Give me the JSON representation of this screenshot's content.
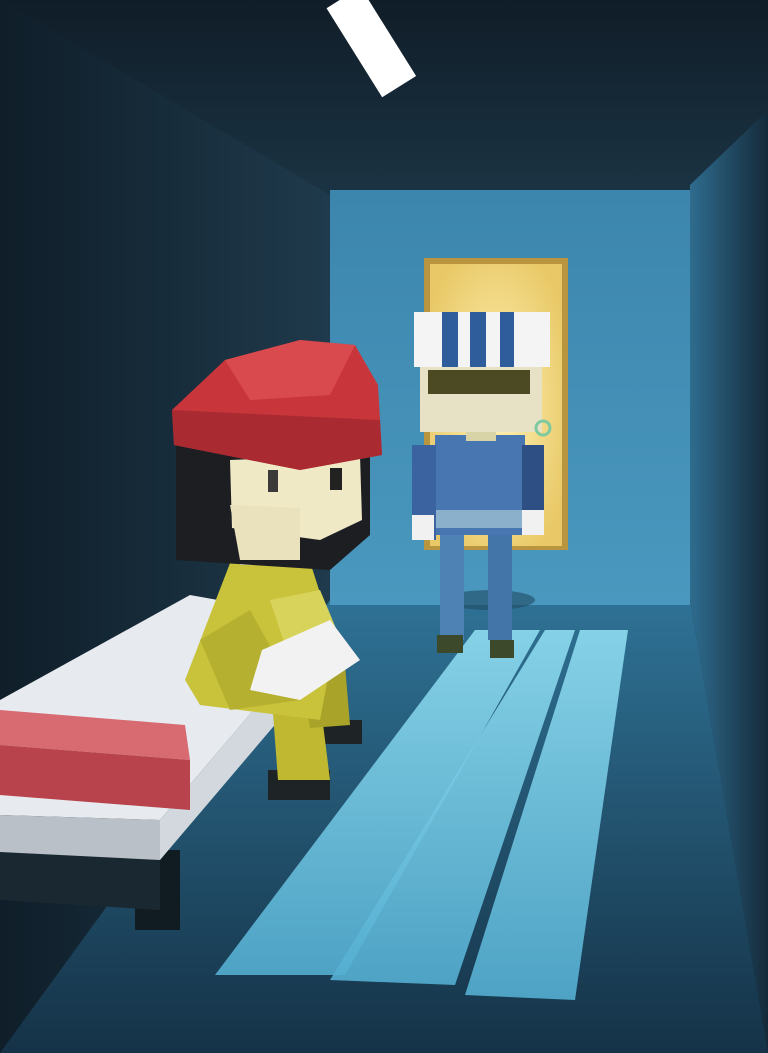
{
  "scene": {
    "description_visible_text": [],
    "colors": {
      "wall_dark": "#122431",
      "wall_lit": "#3d87b0",
      "doorway_light": "#f4dc8a",
      "floor_light": "#5db9d8",
      "cap_red": "#c93b3b",
      "jumpsuit_yellow": "#c7c23a",
      "guard_blue": "#3f6fa8",
      "mattress_white": "#e9ecef",
      "pillow_red": "#c9565e"
    }
  }
}
